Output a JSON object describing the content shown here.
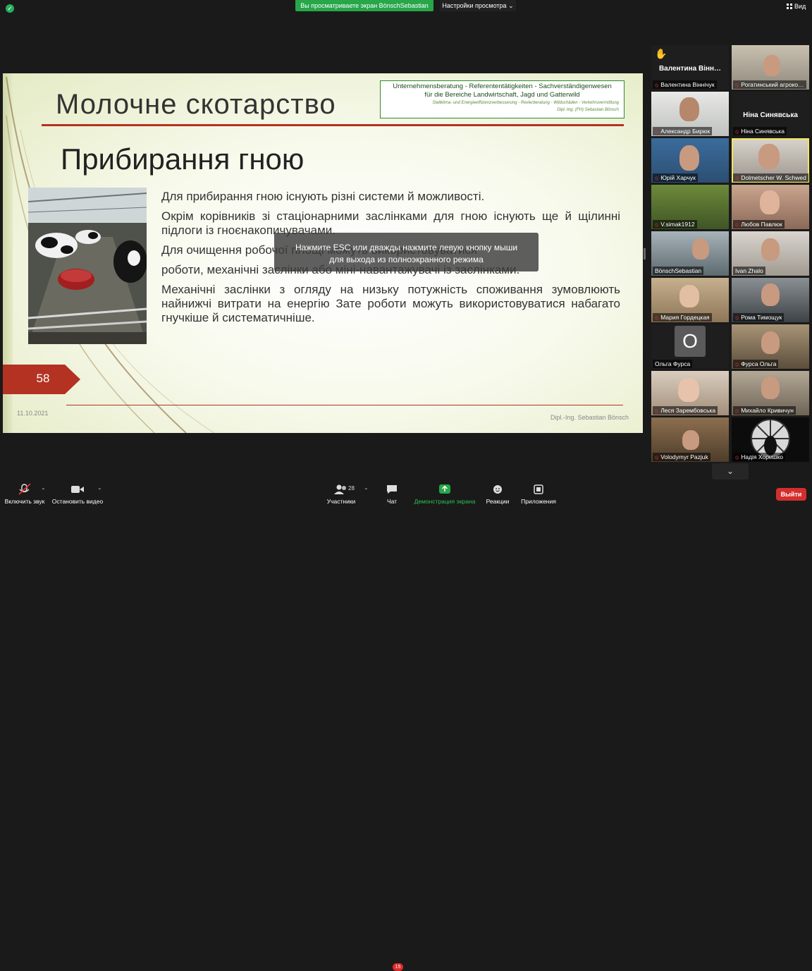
{
  "top": {
    "viewing_banner": "Вы просматриваете экран BönschSebastian",
    "view_options": "Настройки просмотра",
    "view_button": "Вид"
  },
  "slide": {
    "title": "Молочне скотарство",
    "logo_line1": "Unternehmensberatung  -  Referententätigkeiten  - Sachverständigenwesen",
    "logo_line2": "für die Bereiche Landwirtschaft, Jagd und Gatterwild",
    "logo_line3": "Stallklima- und Energieeffizienzverbesserung - Revierberatung - Wildschäden - Verkehrsvermittlung",
    "logo_line4": "Dipl.-Ing. (FH) Sebastian Bönsch",
    "subtitle": "Прибирання гною",
    "para1": "Для прибирання гною існують різні системи й можливості.",
    "para2": "Окрім корівників зі стаціонарними заслінками для гною існують ще й щілинні підлоги із гноєнакопичувачами.",
    "para3": "Для очищення робочої площі можуть використовуватися",
    "para4": "роботи, механічні заслінки або міні-навантажувачі із заслінками.",
    "para5": "Механічні заслінки з огляду на низьку потужність споживання зумовлюють найнижчі витрати на енергію Зате роботи можуть використовуватися набагато гнучкіше й систематичніше.",
    "number": "58",
    "date": "11.10.2021",
    "author": "Dipl.-Ing. Sebastian Bönsch"
  },
  "overlay": {
    "line1": "Нажмите ESC или дважды нажмите левую кнопку мыши",
    "line2": "для выхода из полноэкранного режима"
  },
  "participants": [
    {
      "name": "Валентина Віннічук",
      "big": "Валентина  Вінн…",
      "hand": "✋"
    },
    {
      "name": "Рогатинський агроко…"
    },
    {
      "name": "Александр Бирюк"
    },
    {
      "name": "Ніна Синявська",
      "big": "Ніна Синявська"
    },
    {
      "name": "Юрій Харчук"
    },
    {
      "name": "Dolmetscher W. Schwed"
    },
    {
      "name": "V.simak1912"
    },
    {
      "name": "Любов Павлюк"
    },
    {
      "name": "BönschSebastian"
    },
    {
      "name": "Ivan Zhalo"
    },
    {
      "name": "Мария Гордецкая"
    },
    {
      "name": "Рома Тимощук"
    },
    {
      "name": "Ольга Фурса",
      "big": "О"
    },
    {
      "name": "Фурса Ольга"
    },
    {
      "name": "Леся Зарембовська"
    },
    {
      "name": "Михайло Кривичун"
    },
    {
      "name": "Volodymyr Pazjuk"
    },
    {
      "name": "Надія Хорешко"
    }
  ],
  "toolbar": {
    "mute": "Включить звук",
    "video": "Остановить видео",
    "participants": "Участники",
    "participants_count": "28",
    "chat": "Чат",
    "chat_badge": "15",
    "share": "Демонстрация экрана",
    "reactions": "Реакции",
    "apps": "Приложения",
    "leave": "Выйти"
  },
  "colors": {
    "share_green": "#27a64a",
    "leave_red": "#d42d2d",
    "slide_accent": "#b33222",
    "active_speaker": "#f2e65f"
  }
}
